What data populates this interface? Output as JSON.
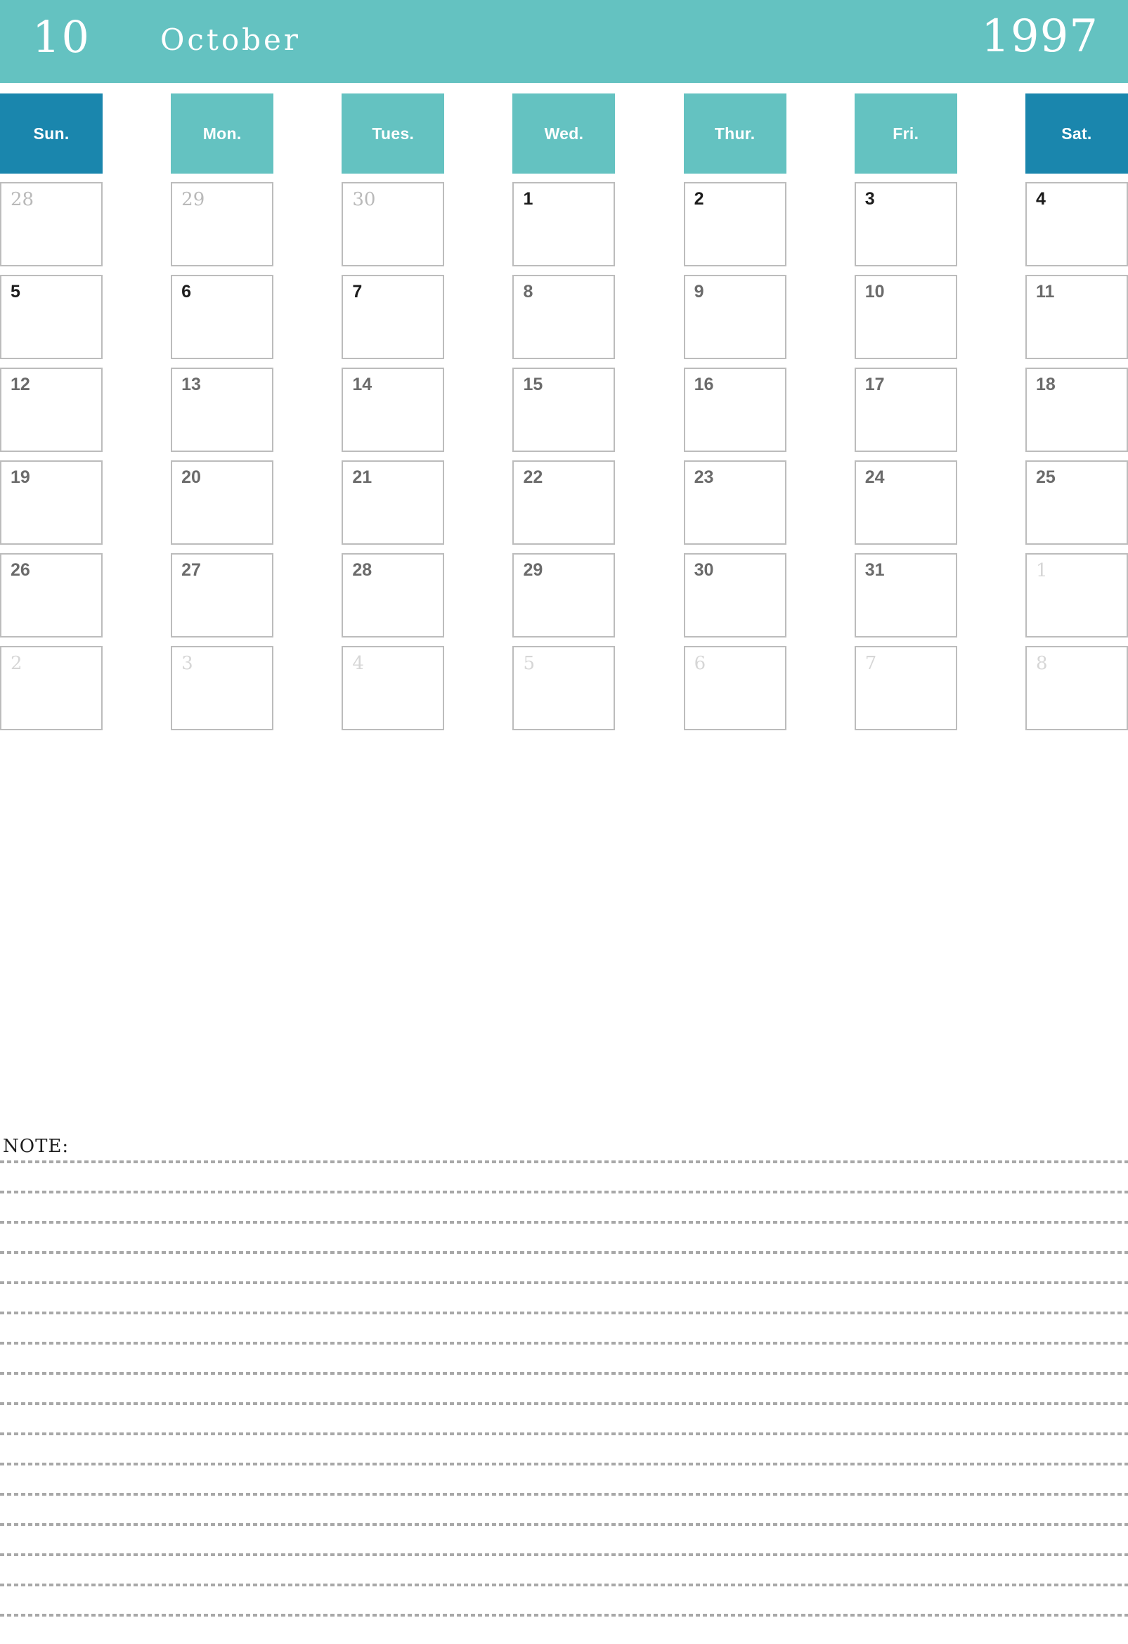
{
  "banner": {
    "month_number": "10",
    "month_name": "October",
    "year": "1997",
    "bg_color": "#64c2c1",
    "text_color": "#ffffff"
  },
  "weekdays": [
    {
      "label": "Sun.",
      "accent": true,
      "color": "#1a86ad"
    },
    {
      "label": "Mon.",
      "accent": false,
      "color": "#64c2c1"
    },
    {
      "label": "Tues.",
      "accent": false,
      "color": "#64c2c1"
    },
    {
      "label": "Wed.",
      "accent": false,
      "color": "#64c2c1"
    },
    {
      "label": "Thur.",
      "accent": false,
      "color": "#64c2c1"
    },
    {
      "label": "Fri.",
      "accent": false,
      "color": "#64c2c1"
    },
    {
      "label": "Sat.",
      "accent": true,
      "color": "#1a86ad"
    }
  ],
  "weeks": [
    [
      {
        "day": "28",
        "style": "out"
      },
      {
        "day": "29",
        "style": "out"
      },
      {
        "day": "30",
        "style": "out"
      },
      {
        "day": "1",
        "style": "cur-strong"
      },
      {
        "day": "2",
        "style": "cur-strong"
      },
      {
        "day": "3",
        "style": "cur-strong"
      },
      {
        "day": "4",
        "style": "cur-strong"
      }
    ],
    [
      {
        "day": "5",
        "style": "cur-strong"
      },
      {
        "day": "6",
        "style": "cur-strong"
      },
      {
        "day": "7",
        "style": "cur-strong"
      },
      {
        "day": "8",
        "style": "cur"
      },
      {
        "day": "9",
        "style": "cur"
      },
      {
        "day": "10",
        "style": "cur"
      },
      {
        "day": "11",
        "style": "cur"
      }
    ],
    [
      {
        "day": "12",
        "style": "cur"
      },
      {
        "day": "13",
        "style": "cur"
      },
      {
        "day": "14",
        "style": "cur"
      },
      {
        "day": "15",
        "style": "cur"
      },
      {
        "day": "16",
        "style": "cur"
      },
      {
        "day": "17",
        "style": "cur"
      },
      {
        "day": "18",
        "style": "cur"
      }
    ],
    [
      {
        "day": "19",
        "style": "cur"
      },
      {
        "day": "20",
        "style": "cur"
      },
      {
        "day": "21",
        "style": "cur"
      },
      {
        "day": "22",
        "style": "cur"
      },
      {
        "day": "23",
        "style": "cur"
      },
      {
        "day": "24",
        "style": "cur"
      },
      {
        "day": "25",
        "style": "cur"
      }
    ],
    [
      {
        "day": "26",
        "style": "cur"
      },
      {
        "day": "27",
        "style": "cur"
      },
      {
        "day": "28",
        "style": "cur"
      },
      {
        "day": "29",
        "style": "cur"
      },
      {
        "day": "30",
        "style": "cur"
      },
      {
        "day": "31",
        "style": "cur"
      },
      {
        "day": "1",
        "style": "out-faint"
      }
    ],
    [
      {
        "day": "2",
        "style": "out-faint"
      },
      {
        "day": "3",
        "style": "out-faint"
      },
      {
        "day": "4",
        "style": "out-faint"
      },
      {
        "day": "5",
        "style": "out-faint"
      },
      {
        "day": "6",
        "style": "out-faint"
      },
      {
        "day": "7",
        "style": "out-faint"
      },
      {
        "day": "8",
        "style": "out-faint"
      }
    ]
  ],
  "note": {
    "label": "NOTE:",
    "line_count": 16
  },
  "colors": {
    "accent_dark": "#1a86ad",
    "accent_light": "#64c2c1",
    "cell_border": "#bcbcbc",
    "dotted_line": "#a8a8a8"
  }
}
